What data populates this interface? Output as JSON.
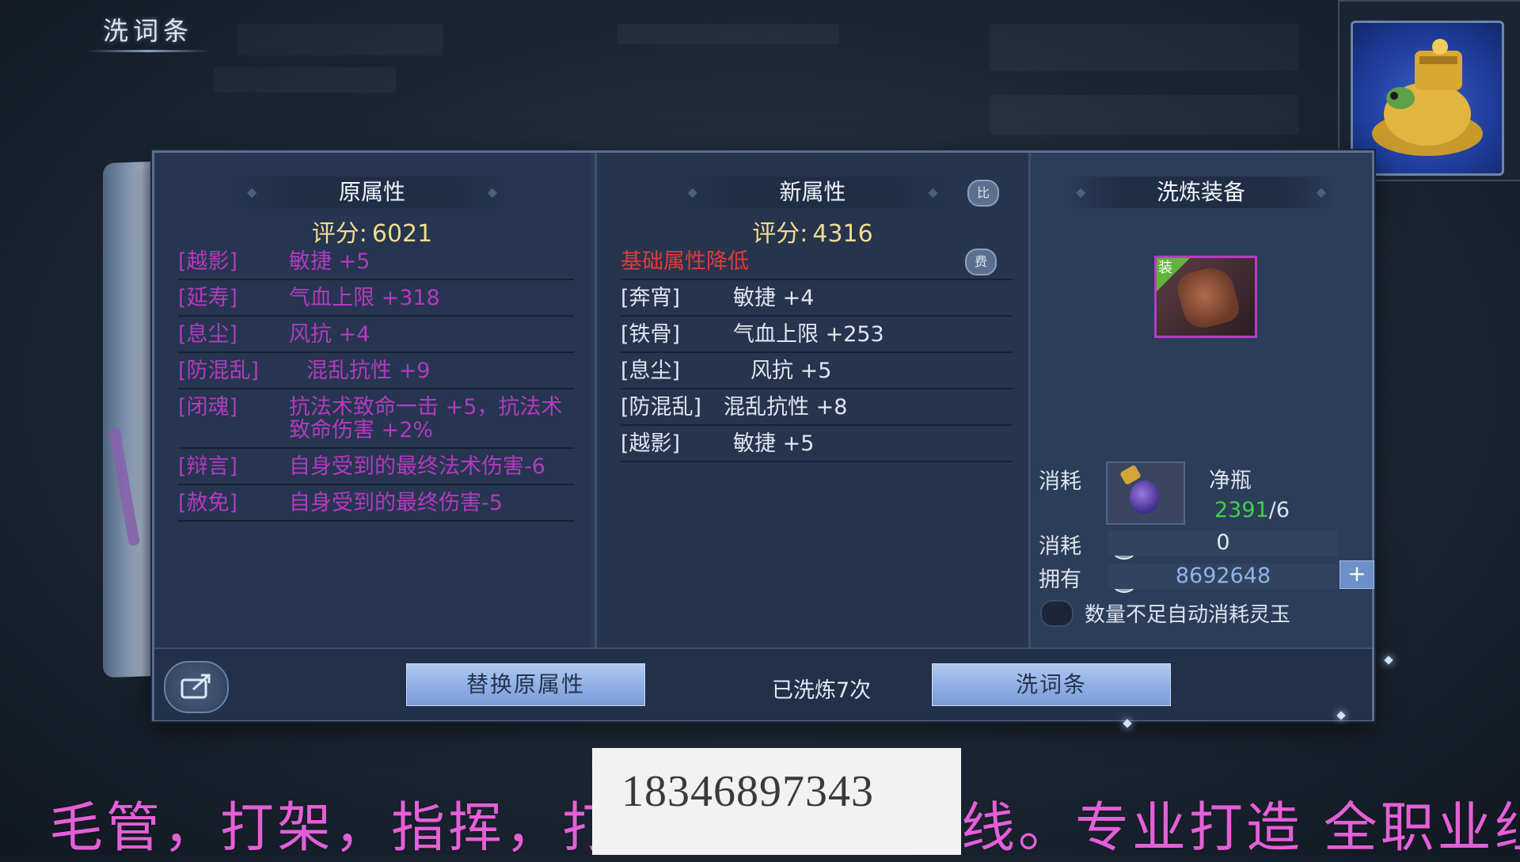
{
  "window": {
    "title": "洗词条"
  },
  "original": {
    "header": "原属性",
    "score_label": "评分:",
    "score": "6021",
    "attrs": [
      {
        "tag": "[越影]",
        "value": "敏捷 +5"
      },
      {
        "tag": "[延寿]",
        "value": "气血上限 +318"
      },
      {
        "tag": "[息尘]",
        "value": "风抗 +4"
      },
      {
        "tag": "[防混乱]",
        "value": "混乱抗性 +9"
      },
      {
        "tag": "[闭魂]",
        "value": "抗法术致命一击 +5，抗法术致命伤害 +2%"
      },
      {
        "tag": "[辩言]",
        "value": "自身受到的最终法术伤害-6"
      },
      {
        "tag": "[赦免]",
        "value": "自身受到的最终伤害-5"
      }
    ]
  },
  "new": {
    "header": "新属性",
    "score_label": "评分:",
    "score": "4316",
    "toggle_icon_text": "比",
    "warning": "基础属性降低",
    "warning_icon_text": "费",
    "attrs": [
      {
        "tag": "[奔宵]",
        "value": "敏捷 +4"
      },
      {
        "tag": "[铁骨]",
        "value": "气血上限 +253"
      },
      {
        "tag": "[息尘]",
        "value": "风抗 +5"
      },
      {
        "tag": "[防混乱]",
        "value": "混乱抗性 +8"
      },
      {
        "tag": "[越影]",
        "value": "敏捷 +5"
      }
    ]
  },
  "equip": {
    "header": "洗炼装备",
    "badge": "装",
    "item_icon": "gauntlet-icon",
    "cost_label": "消耗",
    "material_name": "净瓶",
    "material_have": "2391",
    "material_need": "/6",
    "currency_cost_label": "消耗",
    "currency_cost": "0",
    "own_label": "拥有",
    "own_amount": "8692648",
    "plus": "+",
    "auto_text": "数量不足自动消耗灵玉"
  },
  "bottom": {
    "share_icon": "share-icon",
    "replace_button": "替换原属性",
    "wash_count": "已洗炼7次",
    "wash_button": "洗词条"
  },
  "overlay": {
    "phone": "18346897343",
    "ad": "毛管，打架，指挥，打造，卡龙，卡线。专业打造 全职业组"
  },
  "colors": {
    "purple_attr": "#b33ac0",
    "warning_red": "#e23b3b",
    "score_gold": "#f2dc8a",
    "material_green": "#3fd14a",
    "own_blue": "#8fb4e8",
    "ad_pink": "#e45fd8"
  }
}
